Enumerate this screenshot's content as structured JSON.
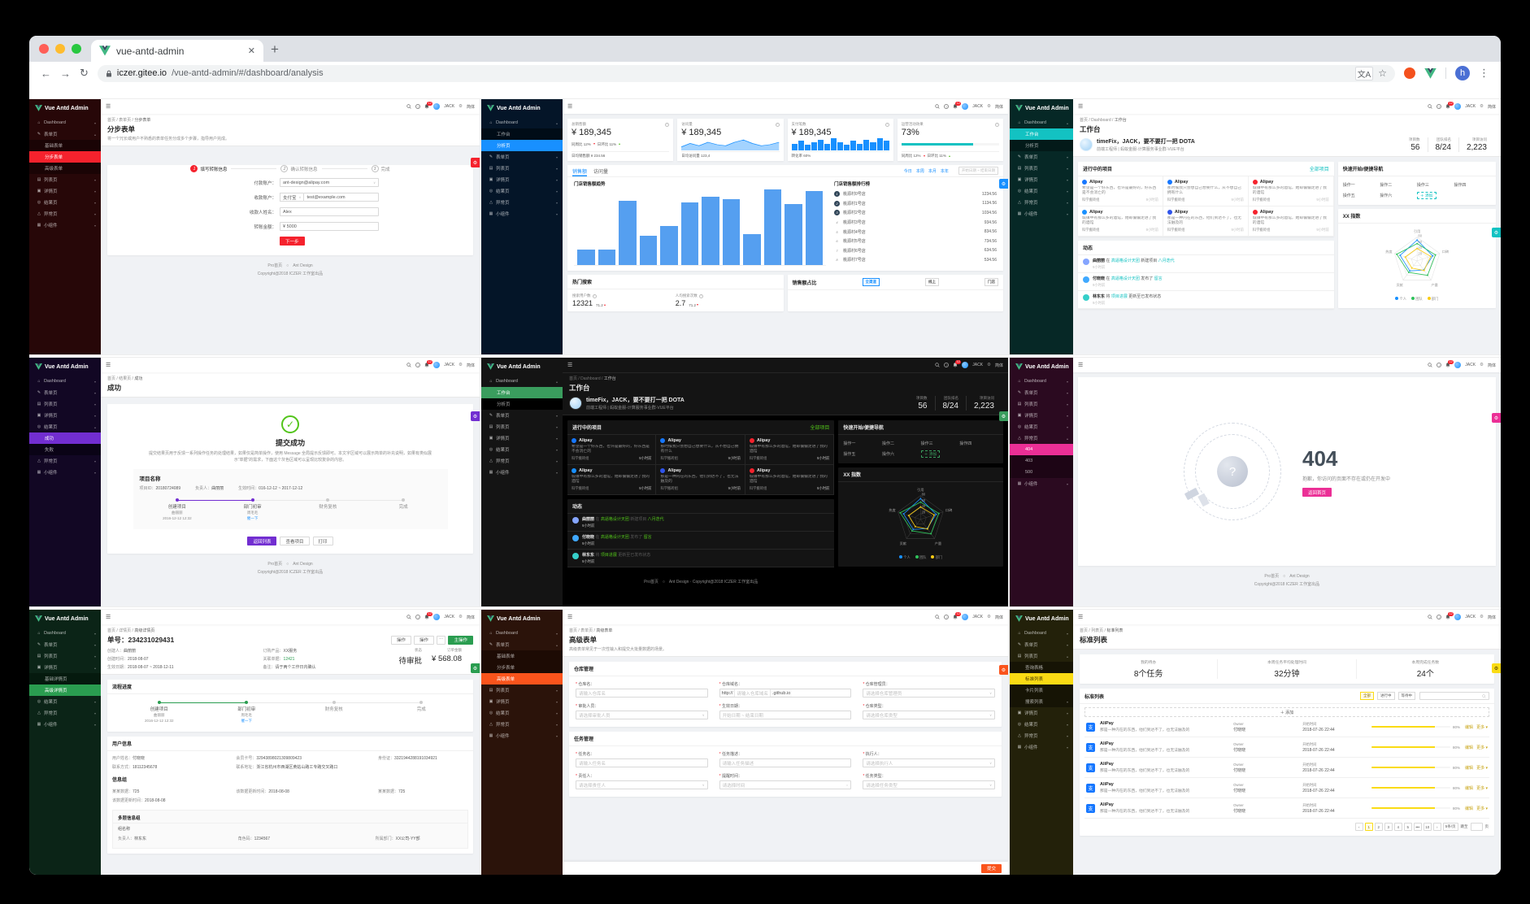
{
  "browser": {
    "tab_title": "vue-antd-admin",
    "close": "✕",
    "new_tab": "+",
    "url_host": "iczer.gitee.io",
    "url_path": "/vue-antd-admin/#/dashboard/analysis",
    "avatar": "h",
    "back": "←",
    "forward": "→",
    "reload": "↻",
    "star": "☆",
    "menu": "⋮"
  },
  "common": {
    "logo": "Vue Antd Admin",
    "header": {
      "badge": "12",
      "user": "JACK",
      "lang": "简体",
      "settings_icon": "⚙",
      "ham": "☰"
    },
    "footer": {
      "pro": "Pro首页",
      "sep": "○",
      "ant": "Ant Design",
      "copyright": "Copyright@2018 ICZER 工作室出品"
    }
  },
  "flow_steps": [
    {
      "label": "创建项目",
      "name": "曲丽丽",
      "time": "2016-12-12 12:32",
      "link": "",
      "cls": "done"
    },
    {
      "label": "部门初审",
      "name": "周毛毛",
      "time": "",
      "link": "催一下",
      "cls": "current"
    },
    {
      "label": "财务复核",
      "name": "",
      "time": "",
      "link": "",
      "cls": "wait"
    },
    {
      "label": "完成",
      "name": "",
      "time": "",
      "link": "",
      "cls": "wait"
    }
  ],
  "ws": {
    "crumb": "首页 / Dashboard / ",
    "crumb_cur": "工作台",
    "title": "工作台",
    "greeting": "timeFix，JACK，要不要打一把 DOTA",
    "sub": "前端工程师 | 蚂蚁金服-计算服务事业群-VUE平台",
    "stats": [
      {
        "label": "项目数",
        "value": "56"
      },
      {
        "label": "团队排名",
        "value": "8/24"
      },
      {
        "label": "项目访问",
        "value": "2,223"
      }
    ],
    "proj_title": "进行中的项目",
    "proj_all": "全部项目",
    "projects": [
      {
        "dot": "#1677ff",
        "name": "Alipay",
        "desc": "希望是一个好东西，也许是最好的，好东西是不会消亡的",
        "group": "科学搬砖组",
        "time": "9小时前"
      },
      {
        "dot": "#1677ff",
        "name": "Alipay",
        "desc": "那时候我只会想自己想要什么，从不想自己拥有什么",
        "group": "科学搬砖组",
        "time": "9小时前"
      },
      {
        "dot": "#f5222d",
        "name": "Alipay",
        "desc": "城镇中有那么多的酒馆，她却偏偏走进了我的酒馆",
        "group": "科学搬砖组",
        "time": "9小时前"
      },
      {
        "dot": "#1890ff",
        "name": "Alipay",
        "desc": "城镇中有那么多的酒馆，她却偏偏走进了我的酒馆",
        "group": "科学搬砖组",
        "time": "9小时前"
      },
      {
        "dot": "#2f54eb",
        "name": "Alipay",
        "desc": "那是一种内在的东西，他们到达不了，也无法触及的",
        "group": "科学搬砖组",
        "time": "9小时前"
      },
      {
        "dot": "#f5222d",
        "name": "Alipay",
        "desc": "城镇中有那么多的酒馆，她却偏偏走进了我的酒馆",
        "group": "科学搬砖组",
        "time": "9小时前"
      }
    ],
    "quick_title": "快速开始/便捷导航",
    "ops": [
      "操作一",
      "操作二",
      "操作三",
      "操作四",
      "操作五",
      "操作六"
    ],
    "add": "＋ 添加",
    "radar_title": "XX 指数",
    "feed_title": "动态",
    "feed": [
      {
        "color": "#85a5ff",
        "user": "曲丽丽",
        "mid": "在",
        "link1": "高逼格设计天团",
        "mid2": "新建项目",
        "link2": "八月迭代",
        "time": "9小时前"
      },
      {
        "color": "#40a9ff",
        "user": "付晓晓",
        "mid": "在",
        "link1": "高逼格设计天团",
        "mid2": "发布了",
        "link2": "留言",
        "time": "9小时前"
      },
      {
        "color": "#36cfc9",
        "user": "林东东",
        "mid": "将",
        "link1": "项目进展",
        "mid2": "更新至已发布状态",
        "link2": "",
        "time": "9小时前"
      }
    ],
    "radar": {
      "axes": [
        "引用",
        "口碑",
        "产量",
        "贡献",
        "热度"
      ],
      "max": 80,
      "ticks": [
        80,
        60,
        40,
        20
      ],
      "series": [
        [
          70,
          55,
          38,
          42,
          60
        ],
        [
          58,
          65,
          60,
          48,
          72
        ],
        [
          42,
          48,
          40,
          30,
          42
        ]
      ],
      "colors": [
        "#1890ff",
        "#2fc25b",
        "#facc14"
      ],
      "legend": [
        "个人",
        "团队",
        "部门"
      ]
    }
  },
  "p1": {
    "accent": "#f5222d",
    "sidebar": [
      {
        "i": "⌂",
        "l": "Dashboard",
        "c": "▾"
      },
      {
        "i": "✎",
        "l": "表单页",
        "c": "▴"
      },
      {
        "l": "基础表单",
        "cls": "sub"
      },
      {
        "l": "分步表单",
        "cls": "sub active"
      },
      {
        "l": "高级表单",
        "cls": "sub"
      },
      {
        "i": "▤",
        "l": "列表页",
        "c": "▾"
      },
      {
        "i": "▣",
        "l": "详情页",
        "c": "▾"
      },
      {
        "i": "◎",
        "l": "结果页",
        "c": "▾"
      },
      {
        "i": "△",
        "l": "异常页",
        "c": "▾"
      },
      {
        "i": "▦",
        "l": "小组件",
        "c": "▾"
      }
    ],
    "crumb": "首页 / 表单页 / ",
    "crumb_cur": "分步表单",
    "title": "分步表单",
    "desc": "将一个冗长或用户不熟悉的表单任务分成多个步骤，指导用户完成。",
    "steps": [
      {
        "n": "1",
        "l": "填写转账信息",
        "cls": "active"
      },
      {
        "n": "2",
        "l": "确认转账信息"
      },
      {
        "n": "3",
        "l": "完成"
      }
    ],
    "f1_label": "付款账户：",
    "f1_value": "ant-design@alipay.com",
    "f2_label": "收款账户：",
    "f2_pre": "支付宝",
    "f2_value": "test@example.com",
    "f3_label": "收款人姓名：",
    "f3_value": "Alex",
    "f4_label": "转账金额：",
    "f4_value": "¥ 5000",
    "next": "下一步"
  },
  "p2": {
    "accent": "#1890ff",
    "sidebar": [
      {
        "i": "⌂",
        "l": "Dashboard",
        "c": "▴"
      },
      {
        "l": "工作台",
        "cls": "sub"
      },
      {
        "l": "分析页",
        "cls": "sub active"
      },
      {
        "i": "✎",
        "l": "表单页",
        "c": "▾"
      },
      {
        "i": "▤",
        "l": "列表页",
        "c": "▾"
      },
      {
        "i": "▣",
        "l": "详情页",
        "c": "▾"
      },
      {
        "i": "◎",
        "l": "结果页",
        "c": "▾"
      },
      {
        "i": "△",
        "l": "异常页",
        "c": "▾"
      },
      {
        "i": "▦",
        "l": "小组件",
        "c": "▾"
      }
    ],
    "cards": {
      "c1_title": "总销售额",
      "c1_value": "¥ 189,345",
      "c1_t1": "同周比 12%",
      "c1_t2": "日环比 11%",
      "c1_foot": "日均销售额 ¥ 234.56",
      "c2_title": "访问量",
      "c2_value": "¥ 189,345",
      "c2_foot": "日均访问量 123,4",
      "spark_area": [
        3,
        6,
        4,
        7,
        5,
        4,
        7,
        9,
        6,
        4,
        5,
        7
      ],
      "c3_title": "支付笔数",
      "c3_value": "¥ 189,345",
      "c3_foot": "转化率 60%",
      "spark_bars": [
        5,
        7,
        4,
        6,
        8,
        5,
        9,
        6,
        4,
        7,
        5,
        8,
        6,
        9,
        7
      ],
      "c4_title": "运营活动效果",
      "c4_value": "73%",
      "c4_percent": 73,
      "c4_t1": "同周比 12%",
      "c4_t2": "日环比 11%"
    },
    "sales": {
      "tab1": "销售额",
      "tab2": "访问量",
      "ranges": [
        "今日",
        "本周",
        "本月",
        "本年"
      ],
      "date_ph": "开始日期 ~ 结束日期",
      "chart_title": "门店销售额趋势",
      "bars": [
        200,
        195,
        820,
        380,
        500,
        800,
        880,
        840,
        400,
        970,
        780,
        950
      ],
      "rank_title": "门店销售额排行榜",
      "rank": [
        {
          "n": "1",
          "name": "桃源村0号店",
          "v": "1234.56",
          "cls": "top"
        },
        {
          "n": "2",
          "name": "桃源村1号店",
          "v": "1134.56",
          "cls": "top"
        },
        {
          "n": "3",
          "name": "桃源村2号店",
          "v": "1034.56",
          "cls": "top"
        },
        {
          "n": "4",
          "name": "桃源村3号店",
          "v": "934.56"
        },
        {
          "n": "5",
          "name": "桃源村4号店",
          "v": "834.56"
        },
        {
          "n": "6",
          "name": "桃源村5号店",
          "v": "734.56"
        },
        {
          "n": "7",
          "name": "桃源村6号店",
          "v": "634.56"
        },
        {
          "n": "8",
          "name": "桃源村7号店",
          "v": "534.56"
        }
      ]
    },
    "hot": {
      "title": "热门搜索",
      "s1_label": "搜索用户数",
      "s1_value": "12321",
      "s1_trend": "71.2",
      "s2_label": "人均搜索次数",
      "s2_value": "2.7",
      "s2_trend": "71.2"
    },
    "share": {
      "title": "销售额占比",
      "btns": [
        {
          "t": "全渠道",
          "cls": "on"
        },
        {
          "t": "线上"
        },
        {
          "t": "门店"
        }
      ]
    }
  },
  "p3": {
    "accent": "#13c2c2",
    "sidebar": [
      {
        "i": "⌂",
        "l": "Dashboard",
        "c": "▴"
      },
      {
        "l": "工作台",
        "cls": "sub active"
      },
      {
        "l": "分析页",
        "cls": "sub"
      },
      {
        "i": "✎",
        "l": "表单页",
        "c": "▾"
      },
      {
        "i": "▤",
        "l": "列表页",
        "c": "▾"
      },
      {
        "i": "▣",
        "l": "详情页",
        "c": "▾"
      },
      {
        "i": "◎",
        "l": "结果页",
        "c": "▾"
      },
      {
        "i": "△",
        "l": "异常页",
        "c": "▾"
      },
      {
        "i": "▦",
        "l": "小组件",
        "c": "▾"
      }
    ]
  },
  "p4": {
    "accent": "#722ed1",
    "sidebar": [
      {
        "i": "⌂",
        "l": "Dashboard",
        "c": "▾"
      },
      {
        "i": "✎",
        "l": "表单页",
        "c": "▾"
      },
      {
        "i": "▤",
        "l": "列表页",
        "c": "▾"
      },
      {
        "i": "▣",
        "l": "详情页",
        "c": "▾"
      },
      {
        "i": "◎",
        "l": "结果页",
        "c": "▴"
      },
      {
        "l": "成功",
        "cls": "sub active"
      },
      {
        "l": "失败",
        "cls": "sub"
      },
      {
        "i": "△",
        "l": "异常页",
        "c": "▾"
      },
      {
        "i": "▦",
        "l": "小组件",
        "c": "▾"
      }
    ],
    "crumb": "首页 / 结果页 / ",
    "crumb_cur": "成功",
    "title": "成功",
    "result_title": "提交成功",
    "result_desc": "提交结果页用于反馈一系列操作任务的处理结果，如果仅是简单操作，使用 Message 全局提示反馈即可。本文字区域可以展示简单的补充说明，如果有类似展示“单据”的需求，下面这个灰色区域可以呈现比较复杂的内容。",
    "box_title": "项目名称",
    "meta": [
      {
        "label": "项目ID：",
        "value": "20180724089"
      },
      {
        "label": "负责人：",
        "value": "曲丽丽"
      },
      {
        "label": "生效时间：",
        "value": "016-12-12 ~ 2017-12-12"
      }
    ],
    "btn1": "返回列表",
    "btn2": "查看项目",
    "btn3": "打印"
  },
  "p5": {
    "accent": "#3a9d5e",
    "sidebar": [
      {
        "i": "⌂",
        "l": "Dashboard",
        "c": "▴"
      },
      {
        "l": "工作台",
        "cls": "sub active"
      },
      {
        "l": "分析页",
        "cls": "sub"
      },
      {
        "i": "✎",
        "l": "表单页",
        "c": "▾"
      },
      {
        "i": "▤",
        "l": "列表页",
        "c": "▾"
      },
      {
        "i": "▣",
        "l": "详情页",
        "c": "▾"
      },
      {
        "i": "◎",
        "l": "结果页",
        "c": "▾"
      },
      {
        "i": "△",
        "l": "异常页",
        "c": "▾"
      },
      {
        "i": "▦",
        "l": "小组件",
        "c": "▾"
      }
    ]
  },
  "p6": {
    "accent": "#eb2f96",
    "sidebar": [
      {
        "i": "⌂",
        "l": "Dashboard",
        "c": "▾"
      },
      {
        "i": "✎",
        "l": "表单页",
        "c": "▾"
      },
      {
        "i": "▤",
        "l": "列表页",
        "c": "▾"
      },
      {
        "i": "▣",
        "l": "详情页",
        "c": "▾"
      },
      {
        "i": "◎",
        "l": "结果页",
        "c": "▾"
      },
      {
        "i": "△",
        "l": "异常页",
        "c": "▴"
      },
      {
        "l": "404",
        "cls": "sub active"
      },
      {
        "l": "403",
        "cls": "sub"
      },
      {
        "l": "500",
        "cls": "sub"
      },
      {
        "i": "▦",
        "l": "小组件",
        "c": "▾"
      }
    ],
    "code": "404",
    "msg": "抱歉，你访问的页面不存在或仍在开发中",
    "btn": "返回首页"
  },
  "p7": {
    "accent": "#2a9d50",
    "sidebar": [
      {
        "i": "⌂",
        "l": "Dashboard",
        "c": "▾"
      },
      {
        "i": "✎",
        "l": "表单页",
        "c": "▾"
      },
      {
        "i": "▤",
        "l": "列表页",
        "c": "▾"
      },
      {
        "i": "▣",
        "l": "详情页",
        "c": "▴"
      },
      {
        "l": "基础详情页",
        "cls": "sub"
      },
      {
        "l": "高级详情页",
        "cls": "sub active"
      },
      {
        "i": "◎",
        "l": "结果页",
        "c": "▾"
      },
      {
        "i": "△",
        "l": "异常页",
        "c": "▾"
      },
      {
        "i": "▦",
        "l": "小组件",
        "c": "▾"
      }
    ],
    "crumb": "首页 / 详情页 / ",
    "crumb_cur": "高级详情页",
    "title": "单号：234231029431",
    "act1": "操作",
    "act2": "操作",
    "act3": "⋯",
    "act_main": "主操作",
    "meta": [
      {
        "label": "创建人：",
        "value": "曲丽丽"
      },
      {
        "label": "订购产品：",
        "value": "XX服务"
      },
      {
        "label": "创建时间：",
        "value": "2018-08-07"
      },
      {
        "label": "关联单据：",
        "value": "12421",
        "cls": "link"
      },
      {
        "label": "生效日期：",
        "value": "2018-08-07 ~ 2018-12-11"
      },
      {
        "label": "备注：",
        "value": "请于两个工作日内确认"
      }
    ],
    "status_label": "状态",
    "status_value": "待审批",
    "amount_label": "订单金额",
    "amount_value": "¥ 568.08",
    "flow_title": "流程进度",
    "user_title": "用户信息",
    "user_rows": [
      {
        "label": "用户姓名：",
        "value": "付晓晓"
      },
      {
        "label": "会员卡号：",
        "value": "32943898021309809423"
      },
      {
        "label": "身份证：",
        "value": "3321944288191034921"
      },
      {
        "label": "联系方式：",
        "value": "18112345678"
      },
      {
        "label": "联系地址：",
        "value": "浙江省杭州市西湖区黄姑山路工专路交叉路口"
      }
    ],
    "group_title": "信息组",
    "info_rows": [
      {
        "label": "某某数据：",
        "value": "725"
      },
      {
        "label": "该数据更新时间：",
        "value": "2018-08-08"
      },
      {
        "label": "某某数据：",
        "value": "725"
      },
      {
        "label": "该数据更新时间：",
        "value": "2018-08-08"
      }
    ],
    "multi_title": "多层信息组",
    "multi_group": "组名称",
    "multi_rows": [
      {
        "label": "负责人：",
        "value": "林东东"
      },
      {
        "label": "角色码：",
        "value": "1234567"
      },
      {
        "label": "所属部门：",
        "value": "XX公司-YY部"
      }
    ]
  },
  "p8": {
    "accent": "#fa541c",
    "sidebar": [
      {
        "i": "⌂",
        "l": "Dashboard",
        "c": "▾"
      },
      {
        "i": "✎",
        "l": "表单页",
        "c": "▴"
      },
      {
        "l": "基础表单",
        "cls": "sub"
      },
      {
        "l": "分步表单",
        "cls": "sub"
      },
      {
        "l": "高级表单",
        "cls": "sub active"
      },
      {
        "i": "▤",
        "l": "列表页",
        "c": "▾"
      },
      {
        "i": "▣",
        "l": "详情页",
        "c": "▾"
      },
      {
        "i": "◎",
        "l": "结果页",
        "c": "▾"
      },
      {
        "i": "△",
        "l": "异常页",
        "c": "▾"
      },
      {
        "i": "▦",
        "l": "小组件",
        "c": "▾"
      }
    ],
    "crumb": "首页 / 表单页 / ",
    "crumb_cur": "高级表单",
    "title": "高级表单",
    "desc": "高级表单常见于一次性输入和提交大批量数据的场景。",
    "card1": "仓库管理",
    "fields1": [
      {
        "label": "仓库名：",
        "ph": "请输入仓库名"
      },
      {
        "label": "仓库域名：",
        "ph": "请输入仓库域名",
        "pre": "http://",
        "suf": ".github.io"
      },
      {
        "label": "仓库管理员：",
        "ph": "请选择仓库管理员",
        "caret": "∨"
      },
      {
        "label": "审批人员：",
        "ph": "请选择审批人员",
        "caret": "∨"
      },
      {
        "label": "生效日期：",
        "ph": "开始日期 ~ 结束日期"
      },
      {
        "label": "仓库类型：",
        "ph": "请选择仓库类型",
        "caret": "∨"
      }
    ],
    "card2": "任务管理",
    "fields2": [
      {
        "label": "任务名：",
        "ph": "请输入任务名"
      },
      {
        "label": "任务描述：",
        "ph": "请输入任务描述"
      },
      {
        "label": "执行人：",
        "ph": "请选择执行人",
        "caret": "∨"
      },
      {
        "label": "责任人：",
        "ph": "请选择责任人",
        "caret": "∨"
      },
      {
        "label": "提醒时间：",
        "ph": "请选择时间",
        "caret": "○"
      },
      {
        "label": "任务类型：",
        "ph": "请选择任务类型",
        "caret": "∨"
      }
    ],
    "submit": "提交"
  },
  "p9": {
    "accent": "#fadb14",
    "sidebar": [
      {
        "i": "⌂",
        "l": "Dashboard",
        "c": "▾"
      },
      {
        "i": "✎",
        "l": "表单页",
        "c": "▾"
      },
      {
        "i": "▤",
        "l": "列表页",
        "c": "▴"
      },
      {
        "l": "查询表格",
        "cls": "sub"
      },
      {
        "l": "标准列表",
        "cls": "sub active"
      },
      {
        "l": "卡片列表",
        "cls": "sub"
      },
      {
        "l": "搜索列表",
        "cls": "sub",
        "c": "▾"
      },
      {
        "i": "▣",
        "l": "详情页",
        "c": "▾"
      },
      {
        "i": "◎",
        "l": "结果页",
        "c": "▾"
      },
      {
        "i": "△",
        "l": "异常页",
        "c": "▾"
      },
      {
        "i": "▦",
        "l": "小组件",
        "c": "▾"
      }
    ],
    "crumb": "首页 / 列表页 / ",
    "crumb_cur": "标准列表",
    "title": "标准列表",
    "stats": [
      {
        "label": "我的待办",
        "value": "8个任务"
      },
      {
        "label": "本周任务平均处理时间",
        "value": "32分钟"
      },
      {
        "label": "本周完成任务数",
        "value": "24个"
      }
    ],
    "list_title": "标准列表",
    "filters": [
      {
        "t": "全部",
        "cls": "on"
      },
      {
        "t": "进行中"
      },
      {
        "t": "等待中"
      }
    ],
    "add": "＋ 添加",
    "rows": [
      {
        "logo": "支",
        "name": "AliPay",
        "desc": "那是一种内在的东西，他们到达不了，也无法触及的",
        "owner_label": "Owner",
        "owner": "付晓晓",
        "time_label": "开始时间",
        "time": "2018-07-26 22:44",
        "percent": 80,
        "pct": "80%",
        "edit": "编辑",
        "more": "更多"
      },
      {
        "logo": "支",
        "name": "AliPay",
        "desc": "那是一种内在的东西，他们到达不了，也无法触及的",
        "owner_label": "Owner",
        "owner": "付晓晓",
        "time_label": "开始时间",
        "time": "2018-07-26 22:44",
        "percent": 80,
        "pct": "80%",
        "edit": "编辑",
        "more": "更多"
      },
      {
        "logo": "支",
        "name": "AliPay",
        "desc": "那是一种内在的东西，他们到达不了，也无法触及的",
        "owner_label": "Owner",
        "owner": "付晓晓",
        "time_label": "开始时间",
        "time": "2018-07-26 22:44",
        "percent": 80,
        "pct": "80%",
        "edit": "编辑",
        "more": "更多"
      },
      {
        "logo": "支",
        "name": "AliPay",
        "desc": "那是一种内在的东西，他们到达不了，也无法触及的",
        "owner_label": "Owner",
        "owner": "付晓晓",
        "time_label": "开始时间",
        "time": "2018-07-26 22:44",
        "percent": 80,
        "pct": "80%",
        "edit": "编辑",
        "more": "更多"
      },
      {
        "logo": "支",
        "name": "AliPay",
        "desc": "那是一种内在的东西，他们到达不了，也无法触及的",
        "owner_label": "Owner",
        "owner": "付晓晓",
        "time_label": "开始时间",
        "time": "2018-07-26 22:44",
        "percent": 80,
        "pct": "80%",
        "edit": "编辑",
        "more": "更多"
      }
    ],
    "pages": [
      {
        "t": "‹"
      },
      {
        "t": "1",
        "cls": "cur"
      },
      {
        "t": "2"
      },
      {
        "t": "3"
      },
      {
        "t": "4"
      },
      {
        "t": "5"
      },
      {
        "t": "•••"
      },
      {
        "t": "10"
      },
      {
        "t": "›"
      }
    ],
    "page_size": "5条/页",
    "jump_pre": "跳至",
    "jump_post": "页"
  }
}
